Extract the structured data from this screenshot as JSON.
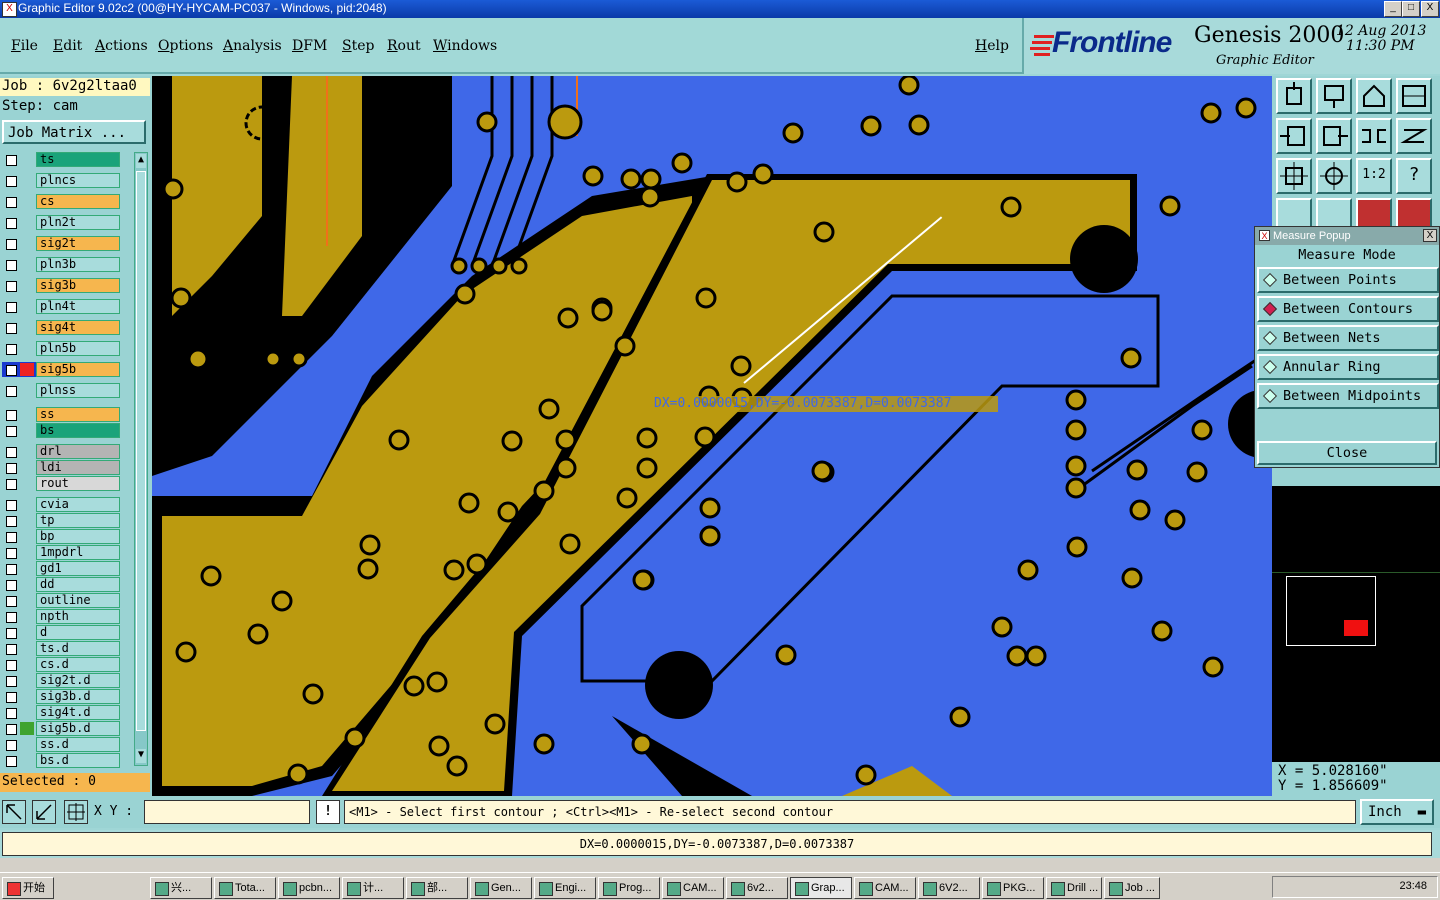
{
  "window": {
    "title": "Graphic Editor 9.02c2 (00@HY-HYCAM-PC037 - Windows, pid:2048)",
    "controls": [
      "_",
      "□",
      "X"
    ]
  },
  "menu": {
    "items": [
      "File",
      "Edit",
      "Actions",
      "Options",
      "Analysis",
      "DFM",
      "Step",
      "Rout",
      "Windows"
    ],
    "help": "Help"
  },
  "logo": {
    "brand": "Frontline",
    "product": "Genesis 2000",
    "subtitle": "Graphic Editor",
    "date": "12 Aug 2013",
    "time": "11:30 PM"
  },
  "job": {
    "job_label": "Job : 6v2g2ltaa0",
    "step_label": "Step: cam",
    "job_matrix_button": "Job Matrix ..."
  },
  "layers": {
    "board_layers": [
      {
        "name": "ts",
        "color": "#1aa37a"
      },
      {
        "name": "plncs",
        "color": "#a8dcdc"
      },
      {
        "name": "cs",
        "color": "#f6b64e"
      },
      {
        "name": "pln2t",
        "color": "#a8dcdc"
      },
      {
        "name": "sig2t",
        "color": "#f6b64e"
      },
      {
        "name": "pln3b",
        "color": "#a8dcdc"
      },
      {
        "name": "sig3b",
        "color": "#f6b64e"
      },
      {
        "name": "pln4t",
        "color": "#a8dcdc"
      },
      {
        "name": "sig4t",
        "color": "#f6b64e"
      },
      {
        "name": "pln5b",
        "color": "#a8dcdc"
      },
      {
        "name": "sig5b",
        "color": "#f6b64e",
        "active": true
      },
      {
        "name": "plnss",
        "color": "#a8dcdc"
      }
    ],
    "mask_layers": [
      {
        "name": "ss",
        "color": "#f6b64e"
      },
      {
        "name": "bs",
        "color": "#1aa37a"
      }
    ],
    "drill_layers": [
      {
        "name": "drl",
        "color": "#b4b4b4"
      },
      {
        "name": "ldi",
        "color": "#b4b4b4"
      },
      {
        "name": "rout",
        "color": "#d8d8d8"
      }
    ],
    "misc_layers": [
      {
        "name": "cvia",
        "color": "#a8dcdc"
      },
      {
        "name": "tp",
        "color": "#a8dcdc"
      },
      {
        "name": "bp",
        "color": "#a8dcdc"
      },
      {
        "name": "1mpdrl",
        "color": "#a8dcdc"
      },
      {
        "name": "gd1",
        "color": "#a8dcdc"
      },
      {
        "name": "dd",
        "color": "#a8dcdc"
      },
      {
        "name": "outline",
        "color": "#a8dcdc"
      },
      {
        "name": "npth",
        "color": "#a8dcdc"
      },
      {
        "name": "d",
        "color": "#a8dcdc"
      },
      {
        "name": "ts.d",
        "color": "#a8dcdc"
      },
      {
        "name": "cs.d",
        "color": "#a8dcdc"
      },
      {
        "name": "sig2t.d",
        "color": "#a8dcdc"
      },
      {
        "name": "sig3b.d",
        "color": "#a8dcdc"
      },
      {
        "name": "sig4t.d",
        "color": "#a8dcdc"
      },
      {
        "name": "sig5b.d",
        "color": "#a8dcdc",
        "marker": "#3fa32f"
      },
      {
        "name": "ss.d",
        "color": "#a8dcdc"
      },
      {
        "name": "bs.d",
        "color": "#a8dcdc"
      }
    ],
    "selected_label": "Selected : 0"
  },
  "canvas": {
    "measure_overlay": "DX=0.0000015,DY=-0.0073387,D=0.0073387",
    "colors": {
      "background": "#3f68e8",
      "copper": "#bb9a0f",
      "black": "#000000"
    }
  },
  "measure_popup": {
    "title": "Measure Popup",
    "mode_label": "Measure Mode",
    "options": [
      {
        "label": "Between Points",
        "selected": false
      },
      {
        "label": "Between Contours",
        "selected": true
      },
      {
        "label": "Between Nets",
        "selected": false
      },
      {
        "label": "Annular Ring",
        "selected": false
      },
      {
        "label": "Between Midpoints",
        "selected": false
      }
    ],
    "close_button": "Close"
  },
  "coords": {
    "x": "X = 5.028160\"",
    "y": "Y = 1.856609\""
  },
  "cmd": {
    "xy_label": "X Y :",
    "xy_value": "",
    "prompt": "<M1> - Select first contour ; <Ctrl><M1> - Re-select second contour",
    "units": "Inch"
  },
  "status": {
    "text": "DX=0.0000015,DY=-0.0073387,D=0.0073387"
  },
  "taskbar": {
    "start": "开始",
    "tasks": [
      "兴...",
      "Tota...",
      "pcbn...",
      "计...",
      "部...",
      "Gen...",
      "Engi...",
      "Prog...",
      "CAM...",
      "6v2...",
      "Grap...",
      "CAM...",
      "6V2...",
      "PKG...",
      "Drill ...",
      "Job ..."
    ],
    "clock": "23:48"
  }
}
